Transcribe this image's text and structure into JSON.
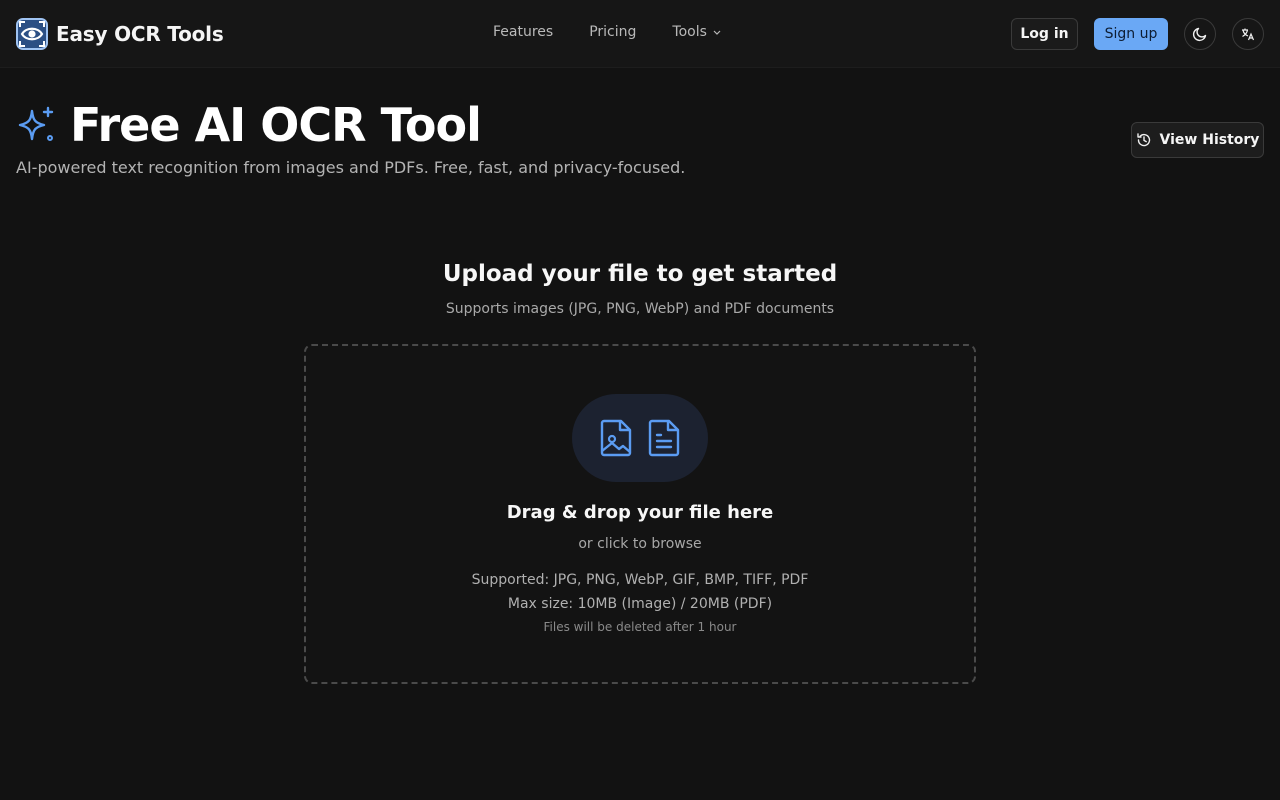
{
  "brand": {
    "name": "Easy OCR Tools"
  },
  "nav": {
    "features": "Features",
    "pricing": "Pricing",
    "tools": "Tools"
  },
  "auth": {
    "login": "Log in",
    "signup": "Sign up"
  },
  "icons": {
    "theme": "moon-icon",
    "language": "translate-icon",
    "history": "history-icon",
    "sparkle": "sparkle-icon"
  },
  "hero": {
    "title": "Free AI OCR Tool",
    "subtitle": "AI-powered text recognition from images and PDFs. Free, fast, and privacy-focused.",
    "history_button": "View History"
  },
  "upload": {
    "title": "Upload your file to get started",
    "subtitle": "Supports images (JPG, PNG, WebP) and PDF documents",
    "drop_title": "Drag & drop your file here",
    "browse": "or click to browse",
    "supported": "Supported: JPG, PNG, WebP, GIF, BMP, TIFF, PDF",
    "max_size": "Max size: 10MB (Image) / 20MB (PDF)",
    "deletion": "Files will be deleted after 1 hour"
  },
  "colors": {
    "background": "#121212",
    "accent": "#6aa8f5",
    "icon_blue": "#5b9cf2"
  }
}
